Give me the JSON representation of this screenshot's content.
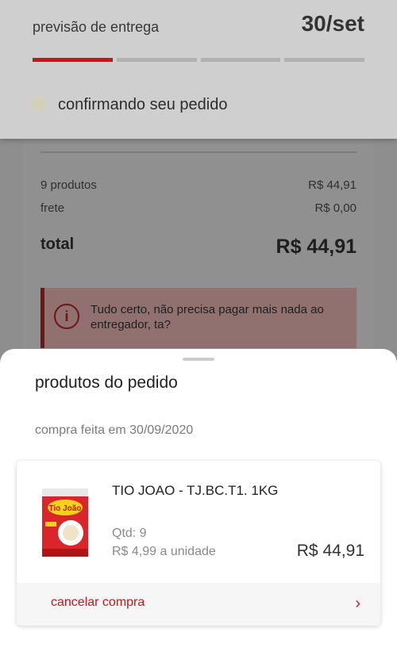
{
  "header": {
    "eta_label": "previsão de entrega",
    "eta_date": "30/set",
    "progress": {
      "total_steps": 4,
      "completed_steps": 1
    },
    "status_text": "confirmando seu pedido"
  },
  "summary": {
    "products_label": "9 produtos",
    "products_value": "R$ 44,91",
    "freight_label": "frete",
    "freight_value": "R$ 0,00",
    "total_label": "total",
    "total_value": "R$ 44,91",
    "alert_icon": "info-icon",
    "alert_text": "Tudo certo, não precisa pagar mais nada ao entregador, ta?"
  },
  "sheet": {
    "title": "produtos do pedido",
    "purchase_date": "compra feita em 30/09/2020",
    "product": {
      "name": "TIO JOAO - TJ.BC.T1. 1KG",
      "qty": "Qtd: 9",
      "unit_price": "R$ 4,99 a unidade",
      "total": "R$ 44,91",
      "image_brand": "Tio João"
    },
    "cancel_label": "cancelar compra"
  },
  "colors": {
    "accent": "#c4161c",
    "overlay": "#8e8e8e"
  }
}
